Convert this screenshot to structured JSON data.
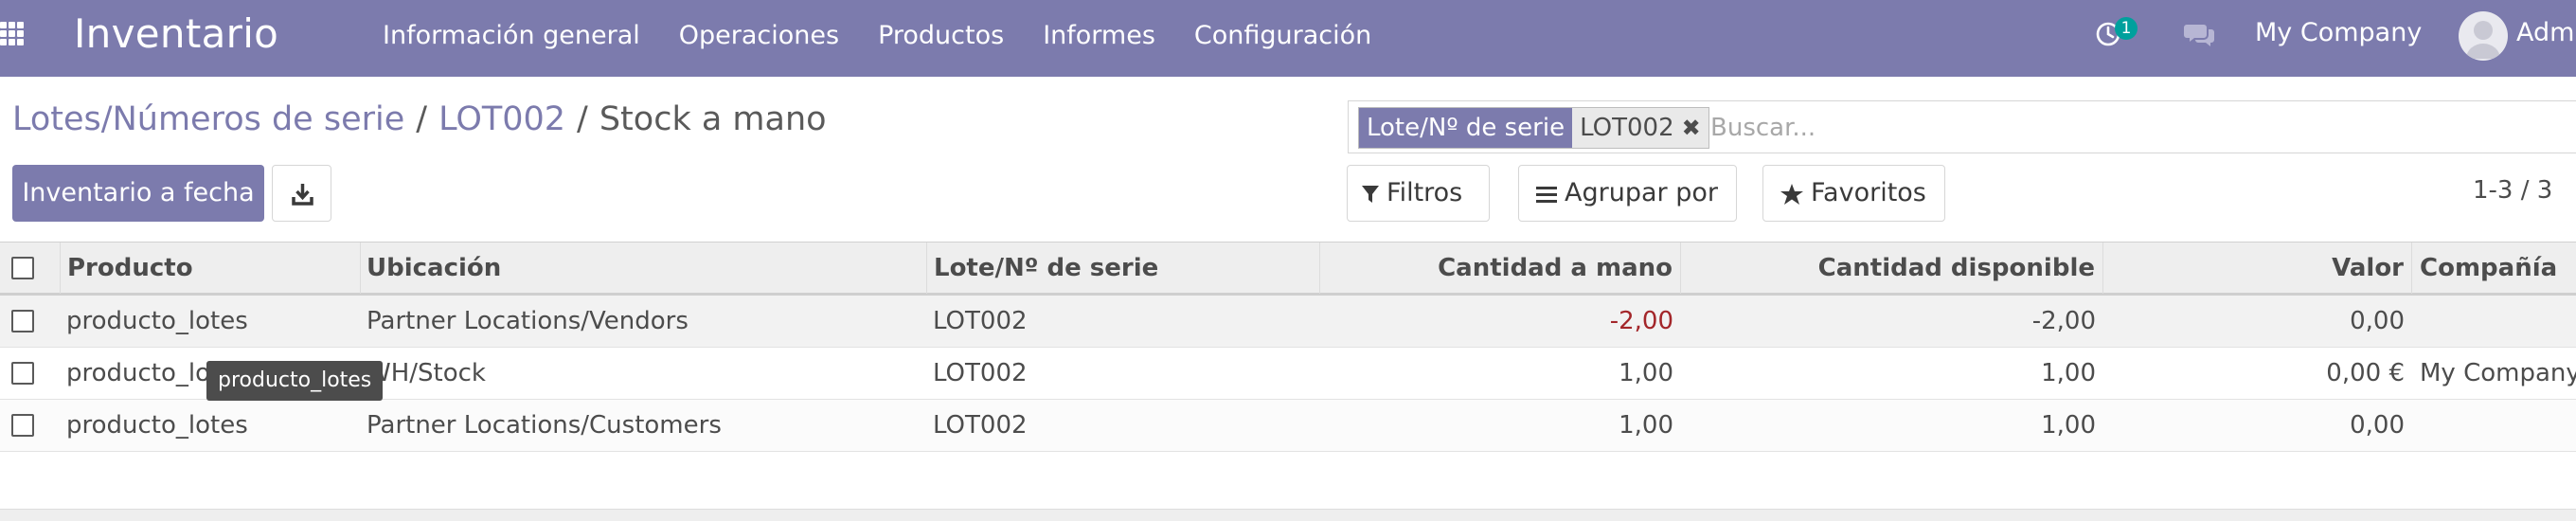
{
  "navbar": {
    "apps_icon": "grid-icon",
    "app_name": "Inventario",
    "menu": [
      "Información general",
      "Operaciones",
      "Productos",
      "Informes",
      "Configuración"
    ],
    "activity_count": "1",
    "company": "My Company",
    "user": "Admi"
  },
  "breadcrumb": {
    "items": [
      "Lotes/Números de serie",
      "LOT002",
      "Stock a mano"
    ],
    "separator": "/"
  },
  "search": {
    "facet_label": "Lote/Nº de serie",
    "facet_value": "LOT002",
    "placeholder": "Buscar..."
  },
  "actions": {
    "primary_label": "Inventario a fecha",
    "download_icon": "download-icon"
  },
  "options": {
    "filters_label": "Filtros",
    "group_by_label": "Agrupar por",
    "favorites_label": "Favoritos"
  },
  "pager": "1-3 / 3",
  "table": {
    "columns": [
      "Producto",
      "Ubicación",
      "Lote/Nº de serie",
      "Cantidad a mano",
      "Cantidad disponible",
      "Valor",
      "Compañía"
    ],
    "rows": [
      {
        "product": "producto_lotes",
        "location": "Partner Locations/Vendors",
        "lot": "LOT002",
        "on_hand": "-2,00",
        "available": "-2,00",
        "value": "0,00",
        "company": ""
      },
      {
        "product": "producto_lotes",
        "location": "WH/Stock",
        "lot": "LOT002",
        "on_hand": "1,00",
        "available": "1,00",
        "value": "0,00 €",
        "company": "My Company"
      },
      {
        "product": "producto_lotes",
        "location": "Partner Locations/Customers",
        "lot": "LOT002",
        "on_hand": "1,00",
        "available": "1,00",
        "value": "0,00",
        "company": ""
      }
    ]
  },
  "tooltip": "producto_lotes",
  "colors": {
    "brand": "#7c7bad",
    "badge": "#00a09d",
    "negative": "#a3262a"
  }
}
